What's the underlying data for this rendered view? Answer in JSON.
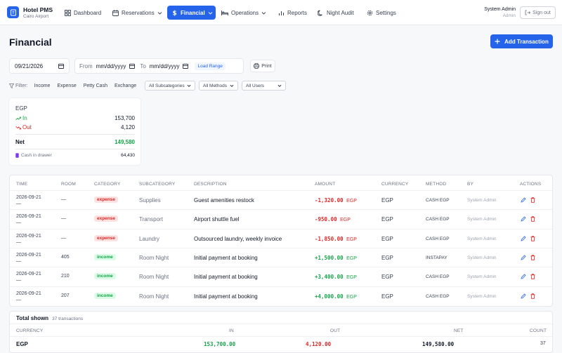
{
  "app": {
    "name": "Hotel PMS",
    "location": "Cairo Airport"
  },
  "nav": [
    {
      "label": "Dashboard",
      "icon": "grid-icon"
    },
    {
      "label": "Reservations",
      "icon": "calendar-icon"
    },
    {
      "label": "Financial",
      "icon": "dollar-icon",
      "active": true
    },
    {
      "label": "Operations",
      "icon": "bed-icon"
    },
    {
      "label": "Reports",
      "icon": "bar-chart-icon"
    },
    {
      "label": "Night Audit",
      "icon": "moon-icon"
    },
    {
      "label": "Settings",
      "icon": "gear-icon"
    }
  ],
  "user": {
    "name": "System Admin",
    "role": "Admin",
    "signout": "Sign out"
  },
  "page": {
    "title": "Financial",
    "add_label": "Add Transaction"
  },
  "toolbar": {
    "date": "09/21/2026",
    "from_label": "From",
    "from_value": "mm/dd/yyyy",
    "to_label": "To",
    "to_value": "mm/dd/yyyy",
    "load_label": "Load Range",
    "print_label": "Print"
  },
  "filters": {
    "label": "Filter:",
    "chips": [
      "Income",
      "Expense",
      "Petty Cash",
      "Exchange"
    ],
    "subcategory": "All Subcategories",
    "methods": "All Methods",
    "users": "All Users"
  },
  "summary": {
    "currency": "EGP",
    "in_label": "In",
    "in_value": "153,700",
    "out_label": "Out",
    "out_value": "4,120",
    "net_label": "Net",
    "net_value": "149,580",
    "drawer_label": "Cash in drawer",
    "drawer_value": "64,430"
  },
  "table": {
    "headers": [
      "TIME",
      "ROOM",
      "CATEGORY",
      "SUBCATEGORY",
      "DESCRIPTION",
      "AMOUNT",
      "CURRENCY",
      "METHOD",
      "BY",
      "ACTIONS"
    ],
    "rows": [
      {
        "date": "2026-09-21",
        "time": "—",
        "room": "—",
        "category": "expense",
        "subcategory": "Supplies",
        "description": "Guest amenities restock",
        "amount": "-1,320.00",
        "ccy": "EGP",
        "currency": "EGP",
        "method": "CASH EGP",
        "by": "System Admin"
      },
      {
        "date": "2026-09-21",
        "time": "—",
        "room": "—",
        "category": "expense",
        "subcategory": "Transport",
        "description": "Airport shuttle fuel",
        "amount": "-950.00",
        "ccy": "EGP",
        "currency": "EGP",
        "method": "CASH EGP",
        "by": "System Admin"
      },
      {
        "date": "2026-09-21",
        "time": "—",
        "room": "—",
        "category": "expense",
        "subcategory": "Laundry",
        "description": "Outsourced laundry, weekly invoice",
        "amount": "-1,850.00",
        "ccy": "EGP",
        "currency": "EGP",
        "method": "CASH EGP",
        "by": "System Admin"
      },
      {
        "date": "2026-09-21",
        "time": "—",
        "room": "405",
        "category": "income",
        "subcategory": "Room Night",
        "description": "Initial payment at booking",
        "amount": "+1,500.00",
        "ccy": "EGP",
        "currency": "EGP",
        "method": "INSTAPAY",
        "by": "System Admin"
      },
      {
        "date": "2026-09-21",
        "time": "—",
        "room": "210",
        "category": "income",
        "subcategory": "Room Night",
        "description": "Initial payment at booking",
        "amount": "+3,400.00",
        "ccy": "EGP",
        "currency": "EGP",
        "method": "CASH EGP",
        "by": "System Admin"
      },
      {
        "date": "2026-09-21",
        "time": "—",
        "room": "207",
        "category": "income",
        "subcategory": "Room Night",
        "description": "Initial payment at booking",
        "amount": "+4,000.00",
        "ccy": "EGP",
        "currency": "EGP",
        "method": "CASH EGP",
        "by": "System Admin"
      }
    ]
  },
  "totals": {
    "title": "Total shown",
    "count_text": "37 transactions",
    "headers": [
      "CURRENCY",
      "IN",
      "OUT",
      "NET",
      "COUNT"
    ],
    "row": {
      "currency": "EGP",
      "in": "153,700.00",
      "out": "4,120.00",
      "net": "149,580.00",
      "count": "37"
    }
  },
  "colors": {
    "accent": "#2563eb",
    "income": "#16a34a",
    "expense": "#dc2626"
  }
}
